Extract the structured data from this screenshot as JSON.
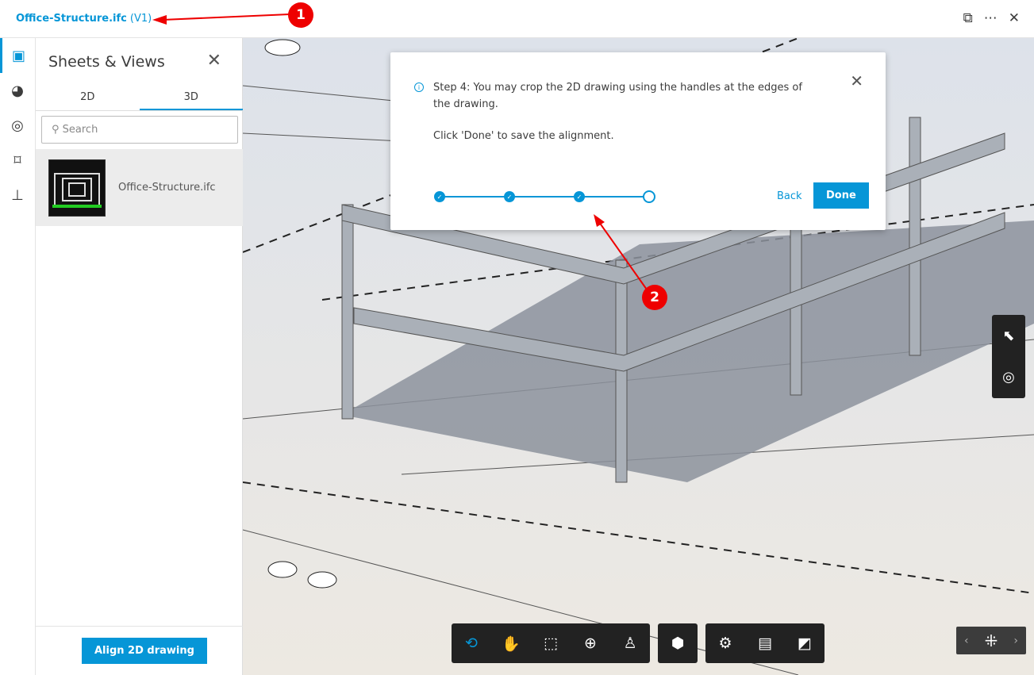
{
  "header": {
    "title": "Office-Structure.ifc",
    "version": "(V1)"
  },
  "panel": {
    "title": "Sheets & Views",
    "tabs": [
      "2D",
      "3D"
    ],
    "active_tab": "3D",
    "search_placeholder": "Search",
    "items": [
      {
        "name": "Office-Structure.ifc"
      }
    ],
    "align_button": "Align 2D drawing"
  },
  "dialog": {
    "step_text": "Step 4: You may crop the 2D drawing using the handles at the edges of the drawing.",
    "instruction": "Click 'Done' to save the alignment.",
    "steps_total": 4,
    "steps_completed": 3,
    "back": "Back",
    "done": "Done"
  },
  "annotations": [
    "1",
    "2"
  ],
  "colors": {
    "accent": "#0696d7",
    "annotation": "#e00000"
  }
}
